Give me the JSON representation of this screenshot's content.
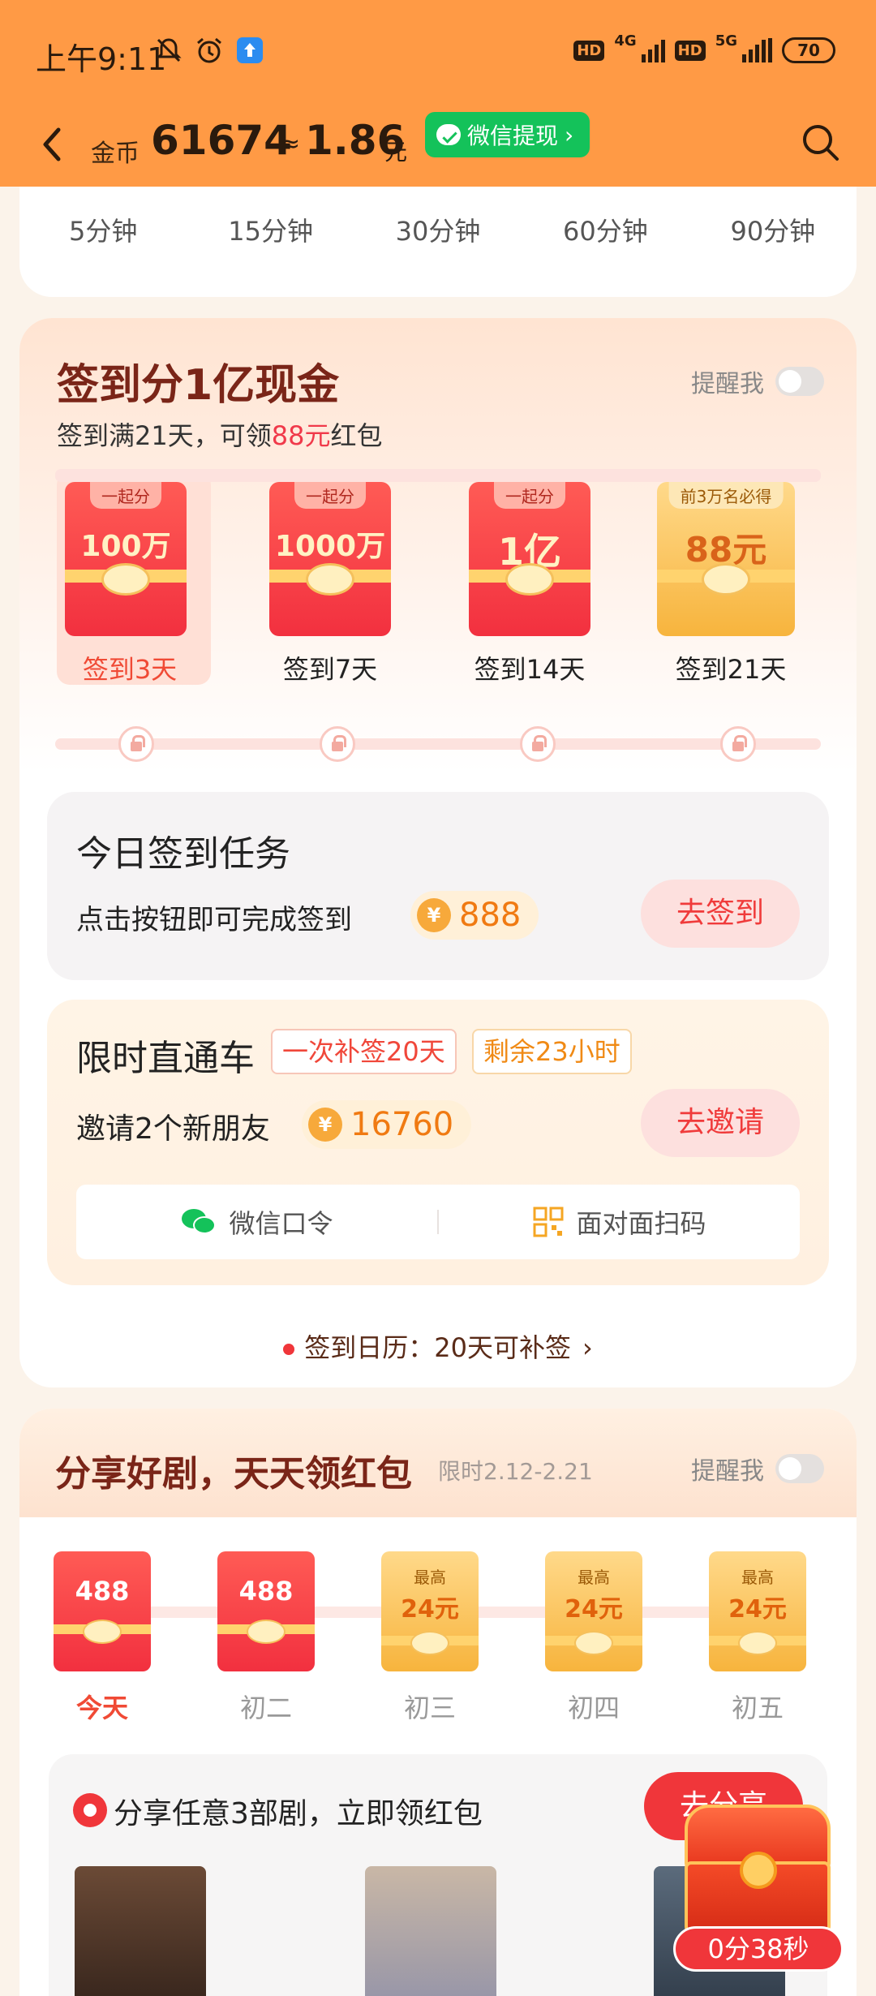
{
  "status_bar": {
    "time": "上午9:11",
    "net1": "4G",
    "net2": "5G",
    "hd": "HD",
    "battery": "70"
  },
  "header": {
    "coin_label": "金币",
    "coin_amount": "61674",
    "approx": "≈",
    "cash_amount": "1.86",
    "cash_unit": "元",
    "withdraw_label": "微信提现"
  },
  "durations": [
    "5分钟",
    "15分钟",
    "30分钟",
    "60分钟",
    "90分钟"
  ],
  "sign_in": {
    "title": "签到分1亿现金",
    "remind_label": "提醒我",
    "subtitle_pre": "签到满21天，可领",
    "subtitle_hl": "88元",
    "subtitle_post": "红包",
    "rewards": [
      {
        "badge": "一起分",
        "amount": "100万",
        "day": "签到3天"
      },
      {
        "badge": "一起分",
        "amount": "1000万",
        "day": "签到7天"
      },
      {
        "badge": "一起分",
        "amount": "1亿",
        "day": "签到14天"
      },
      {
        "badge": "前3万名必得",
        "amount": "88元",
        "day": "签到21天"
      }
    ],
    "task": {
      "title": "今日签到任务",
      "desc": "点击按钮即可完成签到",
      "coin": "888",
      "button": "去签到"
    },
    "limited": {
      "title": "限时直通车",
      "tag1": "一次补签20天",
      "tag2": "剩余23小时",
      "desc": "邀请2个新朋友",
      "coin": "16760",
      "button": "去邀请",
      "wechat": "微信口令",
      "qr": "面对面扫码"
    },
    "calendar": "签到日历：20天可补签"
  },
  "share": {
    "title": "分享好剧，天天领红包",
    "date_range": "限时2.12-2.21",
    "remind_label": "提醒我",
    "days": [
      {
        "top": "",
        "value": "488",
        "label": "今天"
      },
      {
        "top": "",
        "value": "488",
        "label": "初二"
      },
      {
        "top": "最高",
        "value": "24元",
        "label": "初三"
      },
      {
        "top": "最高",
        "value": "24元",
        "label": "初四"
      },
      {
        "top": "最高",
        "value": "24元",
        "label": "初五"
      }
    ],
    "task_title": "分享任意3部剧，立即领红包",
    "task_button": "去分享"
  },
  "float_timer": "0分38秒",
  "colors": {
    "header_bg": "#ff9a45",
    "accent_red": "#f0363a",
    "wechat_green": "#14c25a"
  }
}
